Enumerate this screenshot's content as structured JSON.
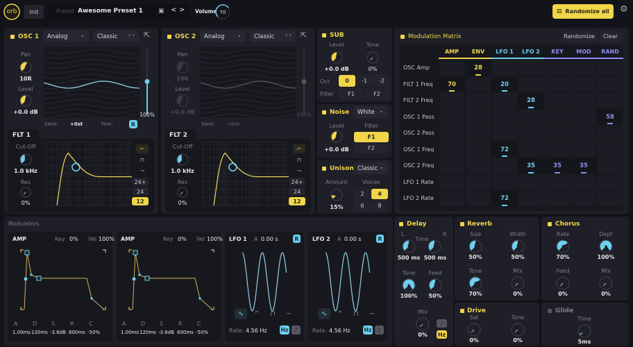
{
  "colors": {
    "yellow": "#f1d54a",
    "cyan": "#6fcfee",
    "purple": "#8a8ef0",
    "panel": "#1e1f27",
    "background": "#131419"
  },
  "header": {
    "logo": "orb",
    "init": "Init",
    "preset_label": "Preset",
    "preset_name": "Awesome Preset 1",
    "save_icon": "save-icon",
    "prev": "<",
    "next": ">",
    "volume_label": "Volume",
    "volume_value": "70",
    "volume_knob": 0.7,
    "randomize_all": "Randomize all",
    "settings_icon": "gear-icon"
  },
  "osc": [
    {
      "title": "OSC 1",
      "type": "Analog",
      "wave": "Classic",
      "enabled": true,
      "pan_label": "Pan",
      "pan_value": "10R",
      "pan_knob": 0.55,
      "level_label": "Level",
      "level_value": "+0.0 dB",
      "level_knob": 0.5,
      "slider_value": "100%",
      "slider_level": 1.0,
      "semi_label": "Semi:",
      "semi_value": "+0st",
      "fine_label": "Fine:",
      "r_label": "R",
      "filter": {
        "title": "FLT 1",
        "cutoff_label": "Cut-Off",
        "cutoff_value": "1.0 kHz",
        "cutoff_knob": 0.45,
        "res_label": "Res",
        "res_value": "0%",
        "res_knob": 0,
        "slopes": [
          "24+",
          "24",
          "12"
        ],
        "active_slope": 2
      }
    },
    {
      "title": "OSC 2",
      "type": "Analog",
      "wave": "Classic",
      "enabled": false,
      "pan_label": "Pan",
      "pan_value": "10R",
      "pan_knob": 0.55,
      "level_label": "Level",
      "level_value": "+0.0 dB",
      "level_knob": 0.5,
      "slider_value": "100%",
      "slider_level": 1.0,
      "semi_label": "Semi:",
      "semi_value": "+0st",
      "filter": {
        "title": "FLT 2",
        "cutoff_label": "Cut-Off",
        "cutoff_value": "1.0 kHz",
        "cutoff_knob": 0.45,
        "res_label": "Res",
        "res_value": "0%",
        "res_knob": 0,
        "slopes": [
          "24+",
          "24",
          "12"
        ],
        "active_slope": 2
      }
    }
  ],
  "sub": {
    "title": "SUB",
    "level_label": "Level",
    "level_value": "+0.0 dB",
    "level_knob": 0.5,
    "tone_label": "Tone",
    "tone_value": "0%",
    "tone_knob": 0,
    "oct_label": "Oct",
    "octs": [
      "0",
      "-1",
      "-2"
    ],
    "active_oct": 0,
    "filter_label": "Filter",
    "filters": [
      "F1",
      "F2"
    ]
  },
  "noise": {
    "title": "Noise",
    "type": "White",
    "level_label": "Level",
    "level_value": "+0.0 dB",
    "level_knob": 0.5,
    "filter_label": "Filter",
    "filters": [
      "F1",
      "F2"
    ],
    "active_filter": 0
  },
  "unison": {
    "title": "Unison",
    "mode": "Classic",
    "amount_label": "Amount",
    "amount_value": "15%",
    "amount_knob": 0.15,
    "voices_label": "Voices",
    "voices": [
      "2",
      "4",
      "6",
      "8"
    ],
    "active_voice": 1
  },
  "matrix": {
    "title": "Modulation Matrix",
    "randomize": "Randomize",
    "clear": "Clear",
    "columns": [
      {
        "label": "AMP",
        "color": "#f1d54a"
      },
      {
        "label": "ENV",
        "color": "#f1d54a"
      },
      {
        "label": "LFO 1",
        "color": "#6fcfee"
      },
      {
        "label": "LFO 2",
        "color": "#6fcfee"
      },
      {
        "label": "KEY",
        "color": "#8a8ef0"
      },
      {
        "label": "MOD",
        "color": "#8a8ef0"
      },
      {
        "label": "RAND",
        "color": "#8a8ef0"
      }
    ],
    "rows": [
      "OSC Amp",
      "FILT 1 Freq",
      "FILT 2 Freq",
      "OSC 1 Pass",
      "OSC 2 Pass",
      "OSC 1 Freq",
      "OSC 2 Freq",
      "LFO 1 Rate",
      "LFO 2 Rate"
    ],
    "cells": [
      {
        "row": 0,
        "col": 1,
        "value": "28"
      },
      {
        "row": 1,
        "col": 0,
        "value": "70"
      },
      {
        "row": 1,
        "col": 2,
        "value": "20"
      },
      {
        "row": 2,
        "col": 3,
        "value": "28"
      },
      {
        "row": 3,
        "col": 6,
        "value": "58"
      },
      {
        "row": 5,
        "col": 2,
        "value": "72"
      },
      {
        "row": 6,
        "col": 3,
        "value": "35"
      },
      {
        "row": 6,
        "col": 4,
        "value": "35"
      },
      {
        "row": 6,
        "col": 5,
        "value": "35"
      },
      {
        "row": 8,
        "col": 2,
        "value": "72"
      }
    ]
  },
  "modulators": {
    "title": "Modulators",
    "envs": [
      {
        "title": "AMP",
        "key_label": "Key",
        "key_value": "0%",
        "vel_label": "Vel",
        "vel_value": "100%",
        "params": [
          {
            "label": "A",
            "value": "1.00ms"
          },
          {
            "label": "D",
            "value": "120ms"
          },
          {
            "label": "S",
            "value": "-3.6dB"
          },
          {
            "label": "R",
            "value": "600ms"
          },
          {
            "label": "C",
            "value": "-50%"
          }
        ]
      },
      {
        "title": "AMP",
        "key_label": "Key",
        "key_value": "0%",
        "vel_label": "Vel",
        "vel_value": "100%",
        "params": [
          {
            "label": "A",
            "value": "1.00ms"
          },
          {
            "label": "D",
            "value": "120ms"
          },
          {
            "label": "S",
            "value": "-3.6dB"
          },
          {
            "label": "R",
            "value": "600ms"
          },
          {
            "label": "C",
            "value": "-50%"
          }
        ]
      }
    ],
    "lfos": [
      {
        "title": "LFO 1",
        "attack_label": "A",
        "attack_value": "0.00 s",
        "r_label": "R",
        "shapes": [
          "sine",
          "triangle",
          "square",
          "random"
        ],
        "active_shape": 0,
        "rate_label": "Rate:",
        "rate_value": "4.56 Hz",
        "hz_label": "Hz"
      },
      {
        "title": "LFO 2",
        "attack_label": "A",
        "attack_value": "0.00 s",
        "r_label": "R",
        "shapes": [
          "sine",
          "triangle",
          "square",
          "random"
        ],
        "active_shape": 0,
        "rate_label": "Rate:",
        "rate_value": "4.56 Hz",
        "hz_label": "Hz"
      }
    ]
  },
  "delay": {
    "title": "Delay",
    "l_label": "L",
    "time_label": "Time",
    "r_label": "R",
    "l_value": "500 ms",
    "l_knob": 0.5,
    "r_value": "500 ms",
    "r_knob": 0.5,
    "tone_label": "Tone",
    "tone_value": "100%",
    "tone_knob": 1.0,
    "feed_label": "Feed",
    "feed_value": "50%",
    "feed_knob": 0.5,
    "mix_label": "Mix",
    "mix_value": "0%",
    "mix_knob": 0,
    "hz_label": "Hz"
  },
  "reverb": {
    "title": "Reverb",
    "size_label": "Size",
    "size_value": "50%",
    "size_knob": 0.5,
    "width_label": "Width",
    "width_value": "50%",
    "width_knob": 0.5,
    "tone_label": "Tone",
    "tone_value": "70%",
    "tone_knob": 0.7,
    "mix_label": "Mix",
    "mix_value": "0%",
    "mix_knob": 0
  },
  "chorus": {
    "title": "Chorus",
    "rate_label": "Rate",
    "rate_value": "70%",
    "rate_knob": 0.7,
    "dept_label": "Dept",
    "dept_value": "100%",
    "dept_knob": 1.0,
    "feed_label": "Feed",
    "feed_value": "0%",
    "feed_knob": 0,
    "mix_label": "Mix",
    "mix_value": "0%",
    "mix_knob": 0
  },
  "drive": {
    "title": "Drive",
    "sat_label": "Sat",
    "sat_value": "0%",
    "sat_knob": 0,
    "tone_label": "Tone",
    "tone_value": "0%",
    "tone_knob": 0
  },
  "glide": {
    "title": "Glide",
    "enabled": false,
    "time_label": "Time",
    "time_value": "5ms",
    "time_knob": 0.05
  }
}
